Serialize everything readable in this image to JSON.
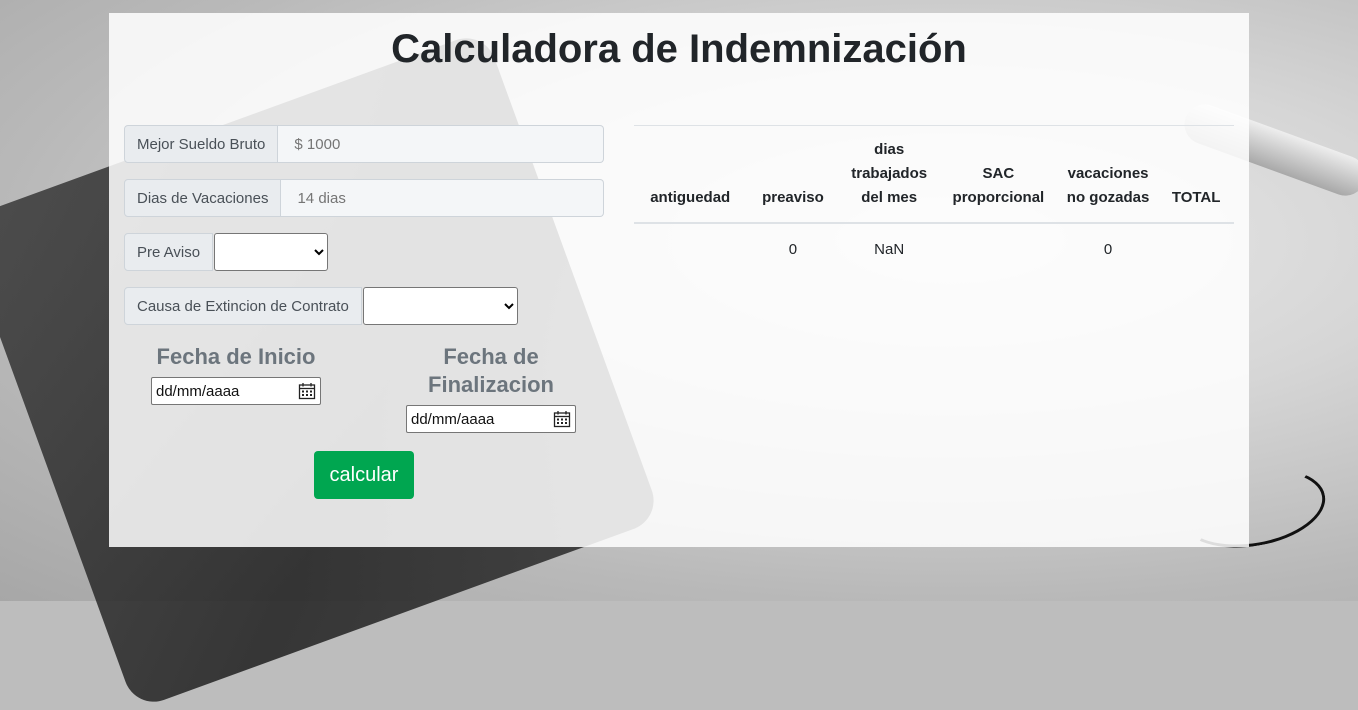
{
  "title": "Calculadora de Indemnización",
  "form": {
    "sueldo_label": "Mejor Sueldo Bruto",
    "sueldo_placeholder": "$ 1000",
    "vacaciones_label": "Dias de Vacaciones",
    "vacaciones_placeholder": "14 dias",
    "preaviso_label": "Pre Aviso",
    "preaviso_value": "",
    "causa_label": "Causa de Extincion de Contrato",
    "causa_value": "",
    "fecha_inicio_label": "Fecha de Inicio",
    "fecha_inicio_value": "dd/mm/aaaa",
    "fecha_fin_label": "Fecha de Finalizacion",
    "fecha_fin_value": "dd/mm/aaaa",
    "calcular_label": "calcular"
  },
  "results": {
    "headers": [
      "antiguedad",
      "preaviso",
      "dias trabajados del mes",
      "SAC proporcional",
      "vacaciones no gozadas",
      "TOTAL"
    ],
    "row": [
      "",
      "0",
      "NaN",
      "",
      "0",
      ""
    ]
  },
  "colors": {
    "button": "#00a650",
    "addon_bg": "#e9ecef"
  }
}
